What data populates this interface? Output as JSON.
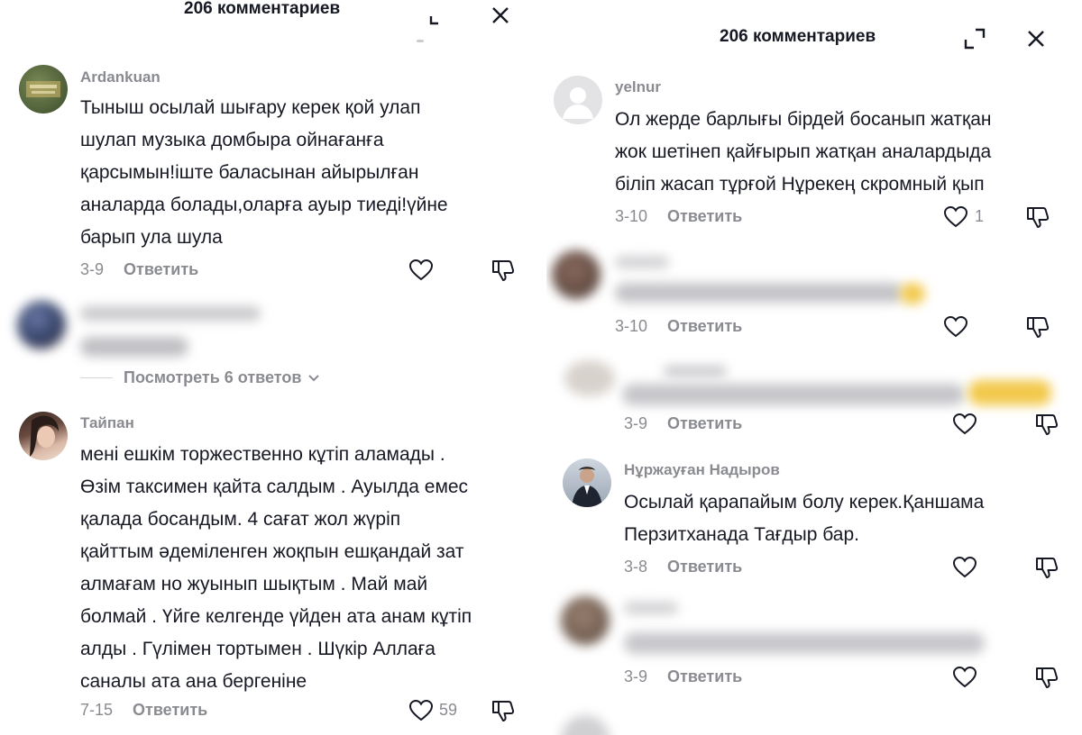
{
  "left": {
    "header_title": "206 комментариев",
    "comments": [
      {
        "user": "Ardankuan",
        "lines": [
          "Тыныш осылай шығару керек қой улап",
          "шулап музыка домбыра ойнағанға",
          "қарсымын!іште баласынан айырылған",
          "аналарда болады,оларға ауыр тиеді!үйне",
          "барып ула шула"
        ],
        "date": "3-9",
        "reply": "Ответить"
      },
      {
        "view_replies": "Посмотреть 6 ответов"
      },
      {
        "user": "Тайпан",
        "lines": [
          "мені ешкім торжественно кұтіп аламады .",
          "Өзім таксимен қайта салдым . Ауылда емес",
          "қалада босандым. 4 сағат жол жүріп",
          "қайттым әдеміленген жоқпын ешқандай зат",
          "алмағам но жуынып шықтым . Май май",
          "болмай . Үйге келгенде үйден ата анам кұтіп",
          "алды . Гүлімен тортымен . Шүкір Аллаға",
          "саналы ата ана бергеніне"
        ],
        "date": "7-15",
        "reply": "Ответить",
        "likes": "59"
      }
    ]
  },
  "right": {
    "header_title": "206 комментариев",
    "comments": [
      {
        "user": "yelnur",
        "lines": [
          "Ол жерде барлығы бірдей босанып жатқан",
          "жок шетінеп қайғырып жатқан аналардыда",
          "біліп жасап тұрғой Нұрекең скромный қып"
        ],
        "date": "3-10",
        "reply": "Ответить",
        "likes": "1"
      },
      {
        "date": "3-10",
        "reply": "Ответить"
      },
      {
        "date": "3-9",
        "reply": "Ответить"
      },
      {
        "user": "Нұржауған Надыров",
        "lines": [
          "Осылай қарапайым болу керек.Қаншама",
          "Перзитханада Тағдыр бар."
        ],
        "date": "3-8",
        "reply": "Ответить"
      },
      {
        "date": "3-9",
        "reply": "Ответить"
      }
    ]
  },
  "colors": {
    "text": "#161823",
    "muted": "#8a8b91",
    "icon": "#161823"
  }
}
